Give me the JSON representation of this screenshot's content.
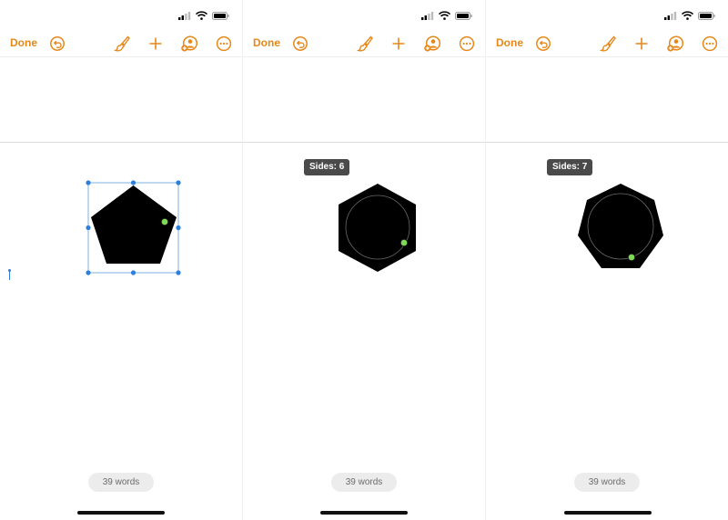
{
  "colors": {
    "accent": "#e6881a",
    "shape_fill": "#000000",
    "handle": "#2d7fdc",
    "control_point": "#7ed957",
    "badge_bg": "#4a4a4a",
    "word_pill_bg": "#ececec"
  },
  "icons": {
    "status": [
      "cellular-signal-icon",
      "wifi-icon",
      "battery-icon"
    ],
    "toolbar": [
      "undo-icon",
      "paintbrush-icon",
      "plus-icon",
      "collaborate-icon",
      "more-icon"
    ]
  },
  "panels": [
    {
      "toolbar": {
        "done_label": "Done"
      },
      "shape": {
        "kind": "pentagon",
        "sides": 5,
        "selected": true
      },
      "word_count": "39 words"
    },
    {
      "toolbar": {
        "done_label": "Done"
      },
      "shape": {
        "kind": "hexagon",
        "sides": 6,
        "selected": false
      },
      "sides_label": "Sides: 6",
      "word_count": "39 words"
    },
    {
      "toolbar": {
        "done_label": "Done"
      },
      "shape": {
        "kind": "heptagon",
        "sides": 7,
        "selected": false
      },
      "sides_label": "Sides: 7",
      "word_count": "39 words"
    }
  ]
}
